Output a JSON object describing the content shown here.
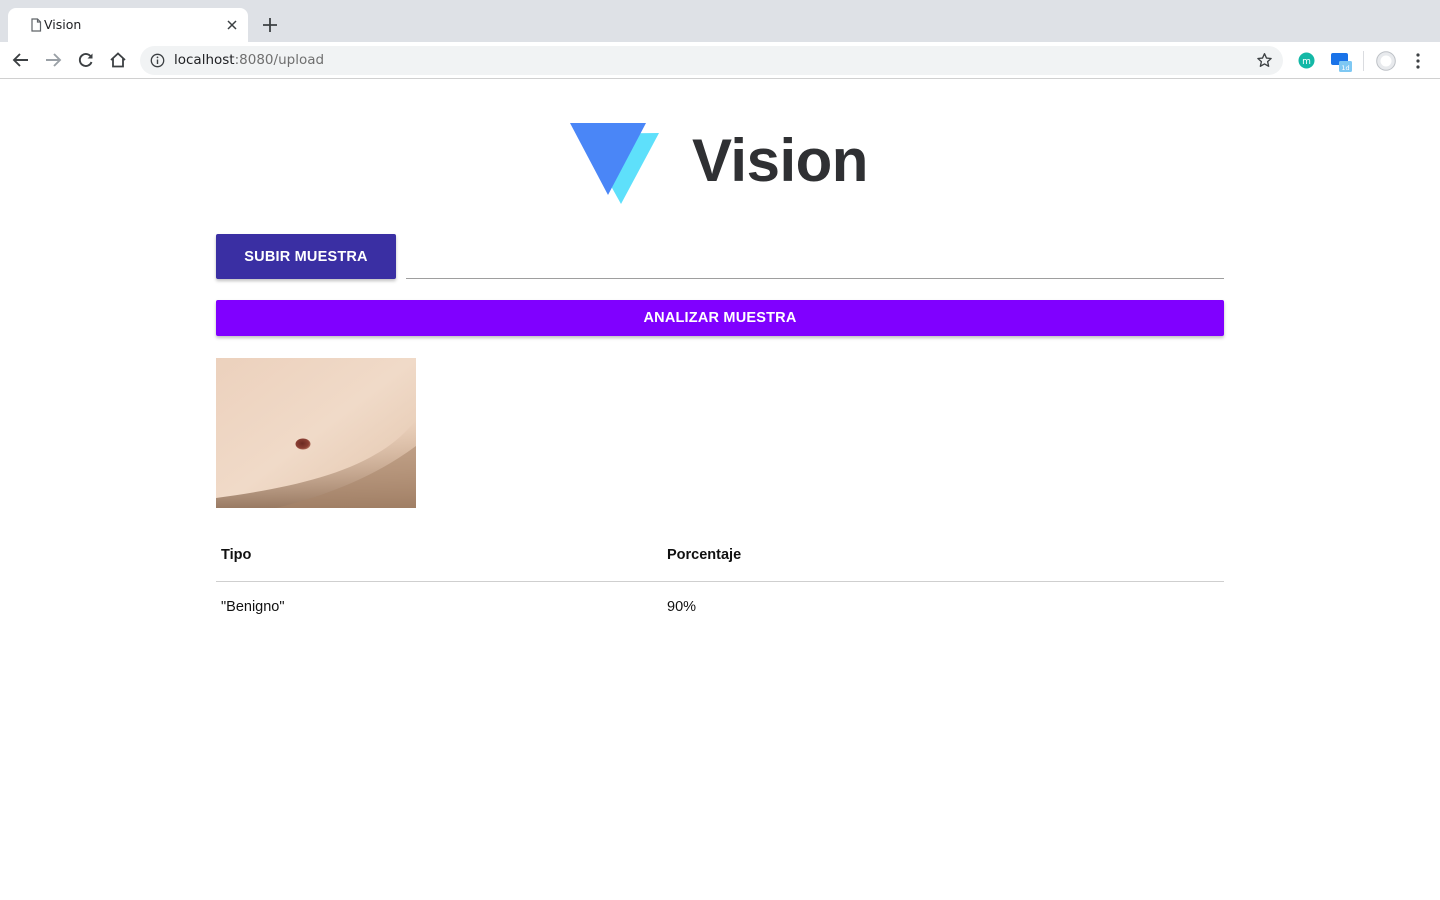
{
  "browser": {
    "tab_title": "Vision",
    "url_host": "localhost",
    "url_rest": ":8080/upload",
    "icons": [
      "page-icon",
      "close-icon",
      "plus-icon",
      "back-icon",
      "forward-icon",
      "reload-icon",
      "home-icon",
      "info-icon",
      "star-icon",
      "menu-icon"
    ]
  },
  "header": {
    "brand": "Vision",
    "logo_colors": {
      "primary": "#4a86f7",
      "secondary": "#5ee0fb"
    }
  },
  "upload": {
    "button_label": "SUBIR MUESTRA",
    "file_value": ""
  },
  "analyze": {
    "button_label": "ANALIZAR MUESTRA"
  },
  "results": {
    "columns": [
      "Tipo",
      "Porcentaje"
    ],
    "rows": [
      {
        "tipo": "\"Benigno\"",
        "porcentaje": "90%"
      }
    ]
  },
  "colors": {
    "upload_button": "#3a2fa3",
    "analyze_button": "#8000ff"
  }
}
